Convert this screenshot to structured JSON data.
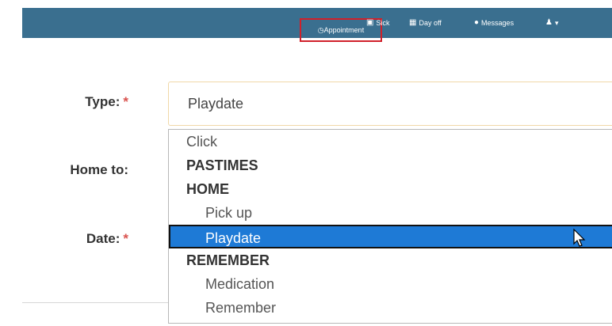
{
  "nav": {
    "appointment": "Appointment",
    "sick": "Sick",
    "dayoff": "Day off",
    "messages": "Messages",
    "user_caret": "▾"
  },
  "form": {
    "type_label": "Type:",
    "home_to_label": "Home to:",
    "date_label": "Date:",
    "required_mark": "*",
    "type_value": "Playdate"
  },
  "dropdown": {
    "options": [
      {
        "text": "Click",
        "kind": "option"
      },
      {
        "text": "PASTIMES",
        "kind": "group"
      },
      {
        "text": "HOME",
        "kind": "group"
      },
      {
        "text": "Pick up",
        "kind": "option"
      },
      {
        "text": "Playdate",
        "kind": "option",
        "selected": true
      },
      {
        "text": "REMEMBER",
        "kind": "group"
      },
      {
        "text": "Medication",
        "kind": "option"
      },
      {
        "text": "Remember",
        "kind": "option"
      }
    ]
  },
  "colors": {
    "nav_bg": "#3a6f8f",
    "highlight": "#d0202a",
    "selected_bg": "#1e7ad6",
    "required": "#d9534f"
  },
  "icons": [
    "clock-icon",
    "calendar-sick-icon",
    "calendar-icon",
    "chat-bubble-icon",
    "user-icon",
    "mouse-cursor-icon"
  ]
}
